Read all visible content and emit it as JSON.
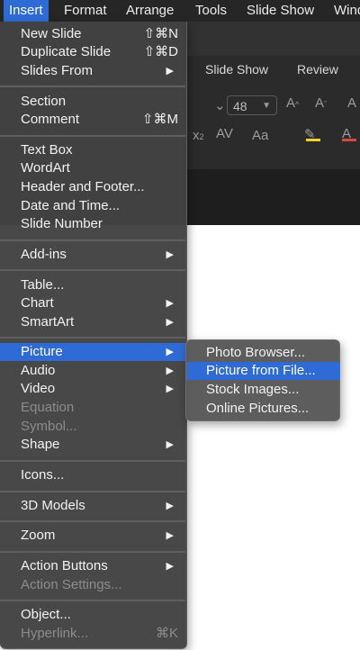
{
  "menubar": {
    "items": [
      "Insert",
      "Format",
      "Arrange",
      "Tools",
      "Slide Show",
      "Window"
    ],
    "active_index": 0
  },
  "ribbon": {
    "tabs": [
      "Slide Show",
      "Review"
    ],
    "font_size": "48"
  },
  "insert_menu": {
    "items": [
      {
        "label": "New Slide",
        "shortcut": "⇧⌘N"
      },
      {
        "label": "Duplicate Slide",
        "shortcut": "⇧⌘D"
      },
      {
        "label": "Slides From",
        "submenu": true
      },
      {
        "label": "Section"
      },
      {
        "label": "Comment",
        "shortcut": "⇧⌘M"
      },
      {
        "label": "Text Box"
      },
      {
        "label": "WordArt"
      },
      {
        "label": "Header and Footer..."
      },
      {
        "label": "Date and Time..."
      },
      {
        "label": "Slide Number"
      },
      {
        "label": "Add-ins",
        "submenu": true
      },
      {
        "label": "Table..."
      },
      {
        "label": "Chart",
        "submenu": true
      },
      {
        "label": "SmartArt",
        "submenu": true
      },
      {
        "label": "Picture",
        "submenu": true,
        "highlighted": true
      },
      {
        "label": "Audio",
        "submenu": true
      },
      {
        "label": "Video",
        "submenu": true
      },
      {
        "label": "Equation",
        "disabled": true
      },
      {
        "label": "Symbol...",
        "disabled": true
      },
      {
        "label": "Shape",
        "submenu": true
      },
      {
        "label": "Icons..."
      },
      {
        "label": "3D Models",
        "submenu": true
      },
      {
        "label": "Zoom",
        "submenu": true
      },
      {
        "label": "Action Buttons",
        "submenu": true
      },
      {
        "label": "Action Settings...",
        "disabled": true
      },
      {
        "label": "Object..."
      },
      {
        "label": "Hyperlink...",
        "shortcut": "⌘K",
        "disabled": true
      }
    ]
  },
  "picture_submenu": {
    "items": [
      {
        "label": "Photo Browser..."
      },
      {
        "label": "Picture from File...",
        "highlighted": true
      },
      {
        "label": "Stock Images..."
      },
      {
        "label": "Online Pictures..."
      }
    ]
  },
  "colors": {
    "highlight": "#2f6bd6",
    "menu_bg": "#424242",
    "menubar_bg": "#262626"
  }
}
